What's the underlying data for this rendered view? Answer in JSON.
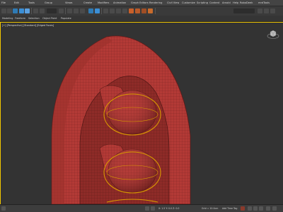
{
  "menu": {
    "items": [
      "File",
      "Edit",
      "Tools",
      "Group",
      "Views",
      "Create",
      "Modifiers",
      "Animation",
      "Graph Editors",
      "Rendering",
      "Civil View",
      "Customize",
      "Scripting",
      "Content",
      "Arnold",
      "Help",
      "RoboDeek",
      "mrdTools"
    ]
  },
  "ribbon": {
    "tabs": [
      "Modeling",
      "Freeform",
      "Selection",
      "Object Paint",
      "Populate"
    ]
  },
  "viewport": {
    "label": "[+] [Perspective] [Standard] [Edged Faces]",
    "mesh_color": "#b33a36",
    "selection_color": "#d99a00"
  },
  "statusbar": {
    "coords": "X: 1.5 Y: 0.0 Z: 0.0",
    "grid": "Grid = 10.0cm",
    "autokey": "Add Time Tag",
    "colors": {
      "autokey_active": "#c0392b"
    }
  }
}
